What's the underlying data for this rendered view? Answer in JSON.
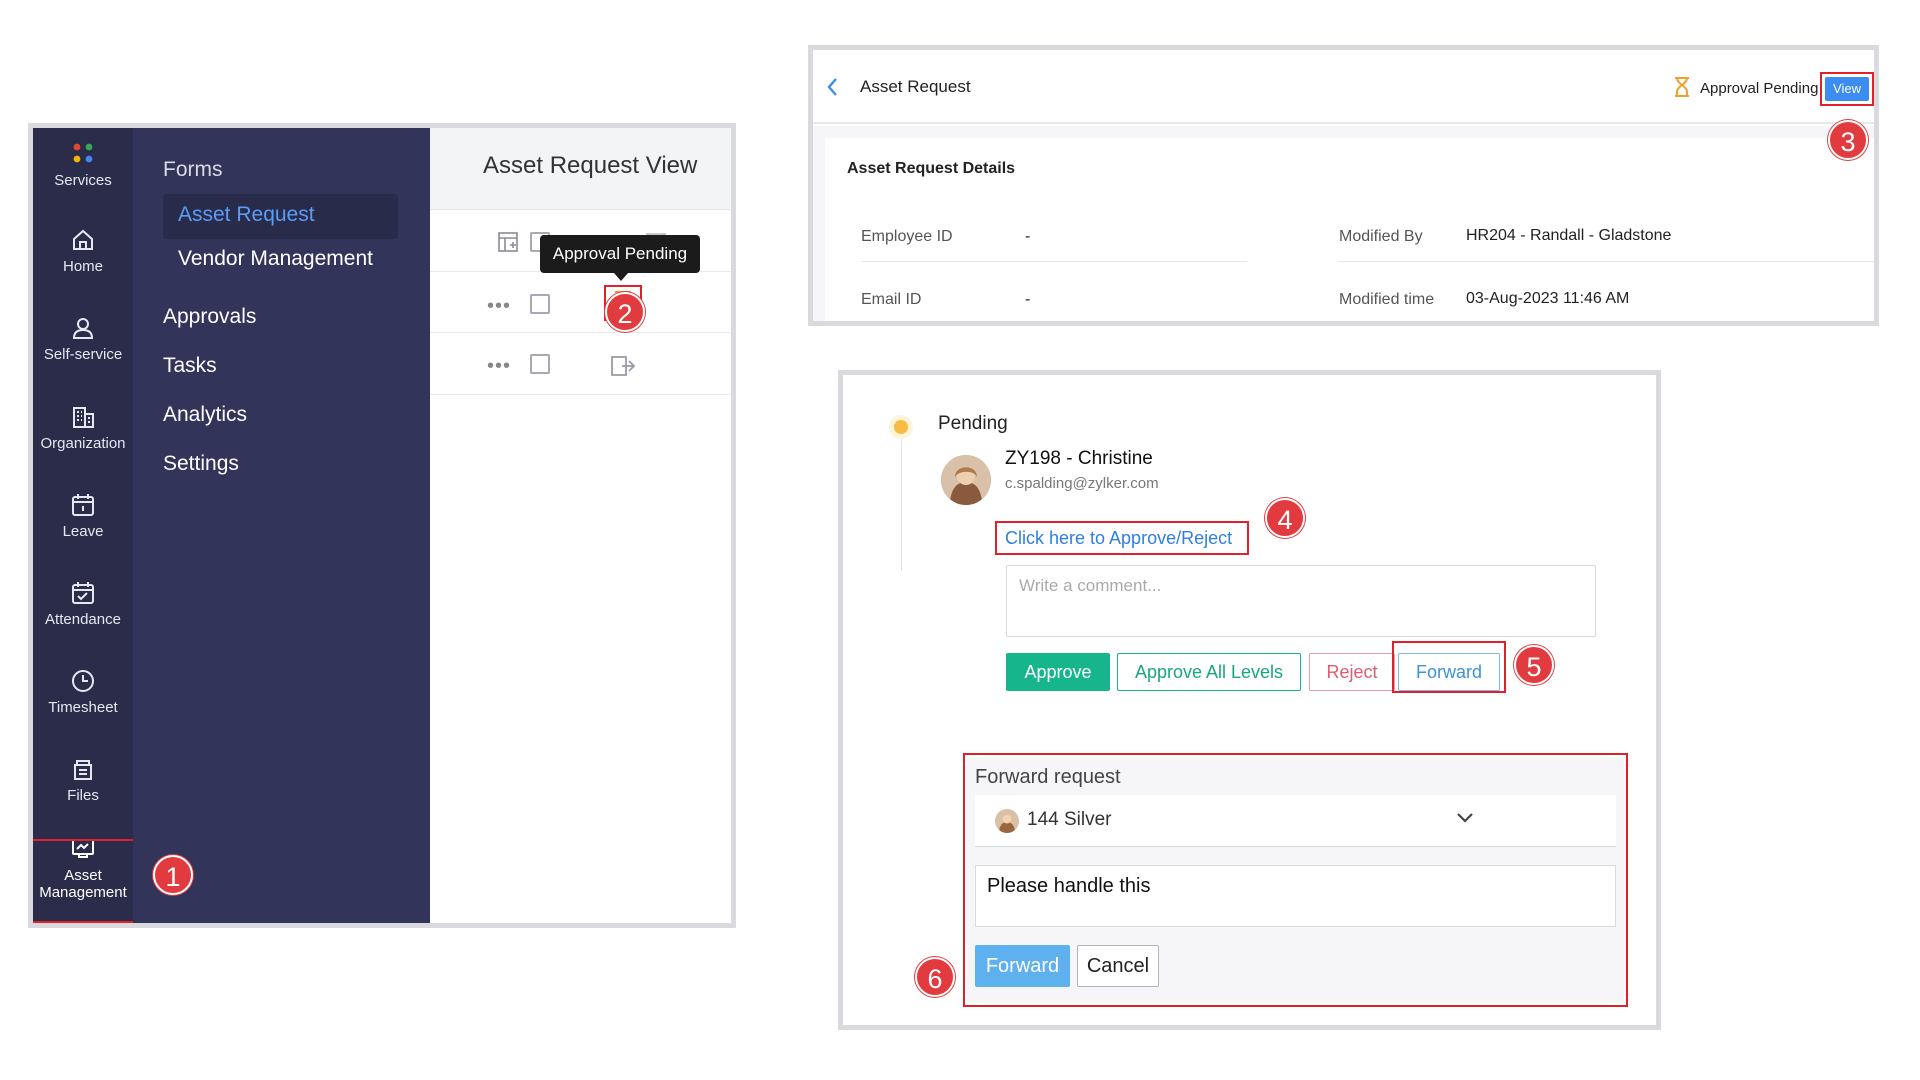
{
  "rail": {
    "services": "Services",
    "home": "Home",
    "self_service": "Self-service",
    "organization": "Organization",
    "leave": "Leave",
    "attendance": "Attendance",
    "timesheet": "Timesheet",
    "files": "Files",
    "asset_line1": "Asset",
    "asset_line2": "Management"
  },
  "submenu": {
    "forms": "Forms",
    "asset_request": "Asset Request",
    "vendor_management": "Vendor Management",
    "approvals": "Approvals",
    "tasks": "Tasks",
    "analytics": "Analytics",
    "settings": "Settings"
  },
  "view": {
    "title": "Asset Request View",
    "tooltip": "Approval Pending",
    "row_more": "•••"
  },
  "detail": {
    "breadcrumb": "Asset Request",
    "status": "Approval Pending",
    "view_button": "View",
    "section_title": "Asset Request Details",
    "employee_id_label": "Employee ID",
    "employee_id_value": "-",
    "email_id_label": "Email ID",
    "email_id_value": "-",
    "modified_by_label": "Modified By",
    "modified_by_value": "HR204 - Randall - Gladstone",
    "modified_time_label": "Modified time",
    "modified_time_value": "03-Aug-2023 11:46 AM"
  },
  "approval": {
    "state": "Pending",
    "approver_name": "ZY198 - Christine",
    "approver_email": "c.spalding@zylker.com",
    "approve_link": "Click here to Approve/Reject",
    "comment_placeholder": "Write a comment...",
    "approve": "Approve",
    "approve_all": "Approve All Levels",
    "reject": "Reject",
    "forward": "Forward"
  },
  "forward_request": {
    "title": "Forward request",
    "selected_user": "144 Silver",
    "message": "Please handle this",
    "forward": "Forward",
    "cancel": "Cancel"
  },
  "steps": [
    "1",
    "2",
    "3",
    "4",
    "5",
    "6"
  ],
  "colors": {
    "rail_bg": "#2a2c4a",
    "submenu_bg": "#32345a",
    "active_link": "#5b9cf6",
    "highlight_red": "#e0202b",
    "badge_red": "#e23b3f",
    "approve_green": "#17b58b",
    "reject_pink": "#e05a70",
    "forward_blue": "#3b93d8",
    "pending_orange": "#f6bc43"
  }
}
